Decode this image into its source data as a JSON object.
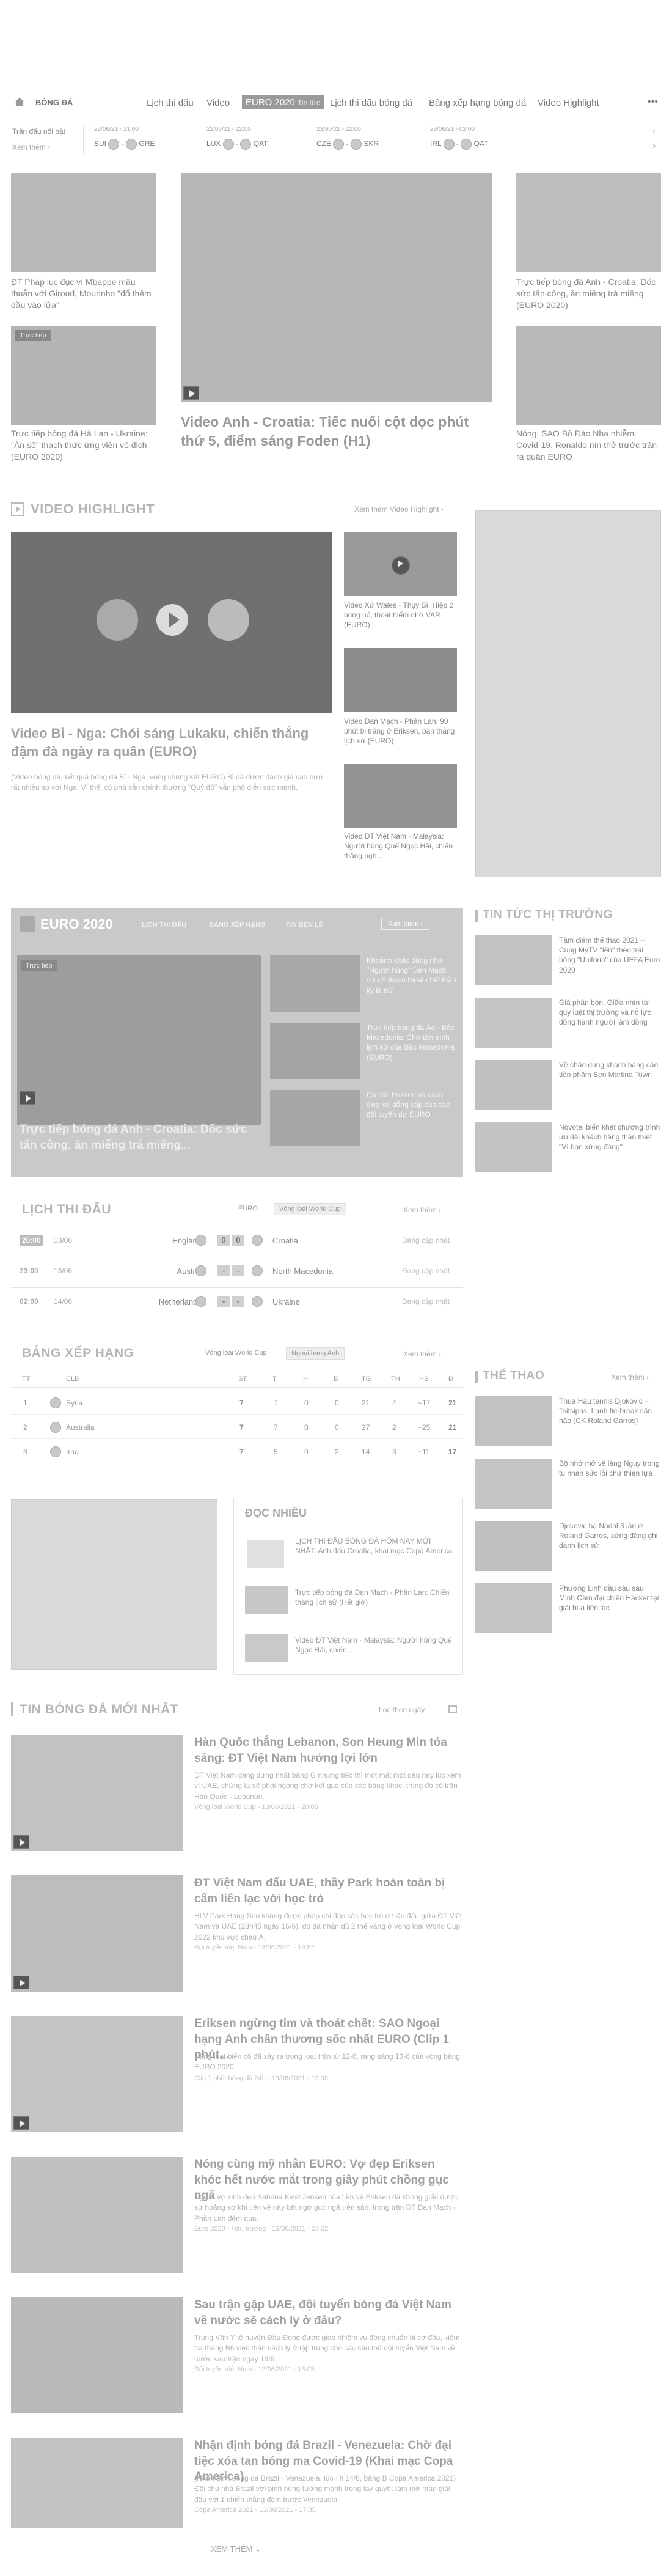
{
  "nav": {
    "logo_label": "BÓNG ĐÁ",
    "items": [
      "Lịch thi đấu",
      "Video",
      "EURO 2020",
      "Tin tức",
      "Lịch thi đấu bóng đá",
      "Bảng xếp hạng bóng đá",
      "Video Highlight"
    ],
    "more": "•••"
  },
  "ticker": {
    "label": "Trận đấu nổi bật",
    "link": "Xem thêm",
    "matches": [
      {
        "date": "22/06/21 - 21:00",
        "home": "SUI",
        "away": "GRE"
      },
      {
        "date": "22/06/21 - 22:00",
        "home": "LUX",
        "away": "QAT"
      },
      {
        "date": "23/06/21 - 22:00",
        "home": "CZE",
        "away": "SKR"
      },
      {
        "date": "23/06/21 - 02:00",
        "home": "IRL",
        "away": "QAT"
      }
    ]
  },
  "top": {
    "left": [
      "ĐT Pháp lục đục vì Mbappe mâu thuẫn với Giroud, Mourinho \"đổ thêm dầu vào lửa\"",
      "Trực tiếp bóng đá Hà Lan - Ukraine: \"Ăn số\" thạch thức ứng viên vô địch (EURO 2020)"
    ],
    "left_badge": "Trực tiếp",
    "main_title": "Video Anh - Croatia: Tiếc nuối cột dọc phút thứ 5, điểm sáng Foden (H1)",
    "right": [
      "Trực tiếp bóng đá Anh - Croatia: Dốc sức tấn công, ăn miếng trả miếng (EURO 2020)",
      "Nóng: SAO Bồ Đào Nha nhiễm Covid-19, Ronaldo nín thở trước trận ra quân EURO"
    ]
  },
  "highlight": {
    "title": "VIDEO HIGHLIGHT",
    "more": "Xem thêm Video Highlight",
    "main_title": "Video Bỉ - Nga: Chói sáng Lukaku, chiến thắng đậm đà ngày ra quân (EURO)",
    "main_desc": "(Video bóng đá, kết quả bóng đá Bỉ - Nga, vòng chung kết EURO) Bỉ đã được đánh giá cao hơn rất nhiều so với Nga. Vì thế, cú phá sẵn chính thường \"Quỷ đỏ\" vẫn phô diễn sức mạnh.",
    "side": [
      "Video Xứ Wales - Thụy Sĩ: Hiệp 2 bùng nổ, thoát hiểm nhờ VAR (EURO)",
      "Video Đan Mạch - Phần Lan: 90 phút bi tráng ở Eriksen, bàn thắng lịch sử (EURO)",
      "Video ĐT Việt Nam - Malaysia: Người hùng Quế Ngọc Hải, chiến thắng ngh..."
    ]
  },
  "euro": {
    "title": "EURO 2020",
    "tabs": [
      "LỊCH THI ĐẤU",
      "BẢNG XẾP HẠNG",
      "TIN BÊN LỀ"
    ],
    "more": "Xem thêm",
    "badge": "Trực tiếp",
    "main_title": "Trực tiếp bóng đá Anh - Croatia: Dốc sức tấn công, ăn miếng trả miếng...",
    "side": [
      "Khoảnh khắc đáng nhớ: \"Người hùng\" Đan Mạch cứu Eriksen thoát chết thần kỳ là ai?",
      "Trực tiếp bóng đá Áo - Bắc Macedonia: Chờ tấn trình lịch sử của Bắc Macedonia (EURO)",
      "Cú sốc Eriksen và cách ứng xử đẳng cấp của các đội tuyển dự EURO"
    ]
  },
  "market": {
    "title": "TIN TỨC THỊ TRƯỜNG",
    "items": [
      "Tâm điểm thế thao 2021 – Cùng MyTV \"lên\" theo trái bóng \"Uniforia\" của UEFA Euro 2020",
      "Giá phân bón: Giữa nhìn từ quy luật thị trường và nỗ lực đồng hành người làm đồng",
      "Về chân dung khách hàng cần tiền phâm Sen Martina Town",
      "Novotel biến khát chương trình ưu đãi khách hàng thân thiết \"Vì bạn xứng đáng\""
    ]
  },
  "schedule": {
    "title": "LỊCH THI ĐẤU",
    "tabs": [
      "EURO",
      "Vòng loại World Cup"
    ],
    "more": "Xem thêm",
    "rows": [
      {
        "time": "20:00",
        "date": "13/06",
        "home": "England",
        "hs": "0",
        "as": "0",
        "away": "Croatia",
        "status": "Đang cập nhật"
      },
      {
        "time": "23:00",
        "date": "13/06",
        "home": "Austria",
        "hs": "-",
        "as": "-",
        "away": "North Macedonia",
        "status": "Đang cập nhật"
      },
      {
        "time": "02:00",
        "date": "14/06",
        "home": "Netherlands",
        "hs": "-",
        "as": "-",
        "away": "Ukraine",
        "status": "Đang cập nhật"
      }
    ]
  },
  "standings": {
    "title": "BẢNG XẾP HẠNG",
    "tabs": [
      "Vòng loại World Cup",
      "Ngoại hạng Anh"
    ],
    "more": "Xem thêm",
    "headers": [
      "TT",
      "CLB",
      "ST",
      "T",
      "H",
      "B",
      "TG",
      "TH",
      "HS",
      "Đ"
    ],
    "rows": [
      [
        "1",
        "Syria",
        "7",
        "7",
        "0",
        "0",
        "21",
        "4",
        "+17",
        "21"
      ],
      [
        "2",
        "Australia",
        "7",
        "7",
        "0",
        "0",
        "27",
        "2",
        "+25",
        "21"
      ],
      [
        "3",
        "Iraq",
        "7",
        "5",
        "0",
        "2",
        "14",
        "3",
        "+11",
        "17"
      ]
    ]
  },
  "sports": {
    "title": "THỂ THAO",
    "more": "Xem thêm",
    "items": [
      "Thua Hậu tennis Djokovic – Tsitsipas: Lạnh tie-break cân não (CK Roland Garros)",
      "Bộ nhớ mở về làng Nguy trong tu nhàn sức lỗi chứ thiện lựa",
      "Djokovic hạ Nadal 3 lần ở Roland Garros, xứng đáng ghi danh lịch sử",
      "Phương Linh đầu sâu sau Minh Cầm đại chiến Hacker tại giải bi-a liên lạc"
    ]
  },
  "most_read": {
    "title": "ĐỌC NHIỀU",
    "items": [
      "LỊCH THI ĐẤU BÓNG ĐÁ HÔM NAY MỚI NHẤT: Anh đấu Croatia, khai mạc Copa America",
      "Trực tiếp bóng đá Đan Mạch - Phần Lan: Chiến thắng lịch sử (Hết giờ)",
      "Video ĐT Việt Nam - Malaysia: Người hùng Quế Ngọc Hải, chiến..."
    ]
  },
  "latest": {
    "title": "TIN BÓNG ĐÁ MỚI NHẤT",
    "filter": "Lọc theo ngày",
    "items": [
      {
        "title": "Hàn Quốc thắng Lebanon, Son Heung Min tỏa sáng: ĐT Việt Nam hưởng lợi lớn",
        "desc": "ĐT Việt Nam đang đứng nhất bảng G nhưng tiếc thì một mất một đầu nay lúc xem vì UAE, chứng ta sẽ phải ngóng chờ kết quả của các bảng khác, trong đó có trận Hàn Quốc - Lebanon.",
        "meta": "Vòng loại World Cup - 13/06/2021 - 20:05"
      },
      {
        "title": "ĐT Việt Nam đấu UAE, thầy Park hoàn toàn bị cấm liên lạc với học trò",
        "desc": "HLV Park Hang Seo không được phép chỉ đạo các học trò ở trận đấu giữa ĐT Việt Nam và UAE (23h45 ngày 15/6), do đã nhận đủ 2 thẻ vàng ở vòng loại World Cup 2022 khu vực châu Á.",
        "meta": "Đội tuyển Việt Nam - 13/06/2021 - 19:52"
      },
      {
        "title": "Eriksen ngừng tim và thoát chết: SAO Ngoại hạng Anh chân thương sốc nhất EURO (Clip 1 phút...",
        "desc": "Hàng loạt biến cố đã xảy ra trong loạt trận từ 12-6, rạng sáng 13-6 của vòng bảng EURO 2020.",
        "meta": "Clip 1 phút bóng đá 24h - 13/06/2021 - 19:00"
      },
      {
        "title": "Nóng cùng mỹ nhân EURO: Vợ đẹp Eriksen khóc hết nước mắt trong giây phút chồng gục ngã",
        "desc": "Người vợ xinh đẹp Sabrina Kvist Jensen của tiền vệ Eriksen đã không giấu được sự hoảng sợ khi tiền vệ này bất ngờ gục ngã trên sân, trong trận ĐT Đan Mạch - Phần Lan đêm qua.",
        "meta": "Euro 2020 - Hậu trường - 13/06/2021 - 18:32"
      },
      {
        "title": "Sau trận gặp UAE, đội tuyển bóng đá Việt Nam về nước sẽ cách ly ở đâu?",
        "desc": "Trung Văn Y tế huyện Đầu Đọng được giao nhiệm vụ đồng chuẩn bị cơ đầu, kiêm tra tháng B6 việc thân cách ly ở tập trung cho các cầu thủ đội tuyển Việt Nam về nước sau trận ngày 15/6.",
        "meta": "Đội tuyển Việt Nam - 13/06/2021 - 18:05"
      },
      {
        "title": "Nhận định bóng đá Brazil - Venezuela: Chờ đại tiệc xóa tan bóng ma Covid-19 (Khai mạc Copa America)",
        "desc": "(Nhận định bóng đá Brazil - Venezuela, lúc 4h 14/6, bảng B Copa America 2021) Đội chủ nhà Brazil với binh hùng tướng mạnh trong tay quyết tâm mở màn giải đấu với 1 chiến thắng đậm trước Venezuela.",
        "meta": "Copa America 2021 - 13/06/2021 - 17:35"
      }
    ],
    "more": "XEM THÊM"
  },
  "colors": {
    "bg": "#ffffff",
    "placeholder": "#d9d9d9",
    "euro_bg": "#c9c9c9"
  }
}
